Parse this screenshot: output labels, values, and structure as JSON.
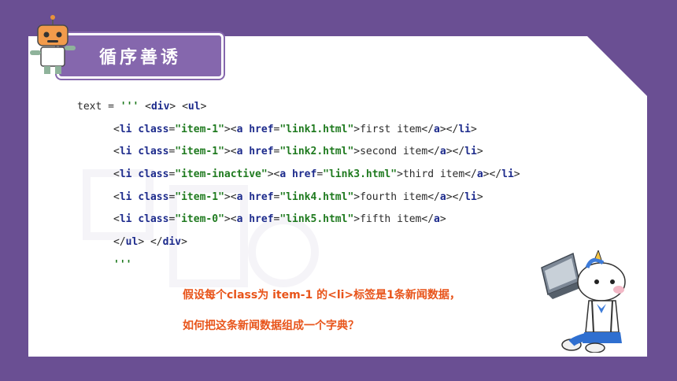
{
  "title": "循序善诱",
  "code_lines": [
    {
      "parts": [
        [
          "pl",
          "text = "
        ],
        [
          "st",
          "'''"
        ],
        [
          "pl",
          " <"
        ],
        [
          "kw",
          "div"
        ],
        [
          "pl",
          "> <"
        ],
        [
          "kw",
          "ul"
        ],
        [
          "pl",
          ">"
        ]
      ],
      "indent": false
    },
    {
      "parts": [
        [
          "pl",
          "<"
        ],
        [
          "kw",
          "li"
        ],
        [
          "pl",
          " "
        ],
        [
          "at",
          "class"
        ],
        [
          "pl",
          "="
        ],
        [
          "st",
          "\"item-1\""
        ],
        [
          "pl",
          "><"
        ],
        [
          "kw",
          "a"
        ],
        [
          "pl",
          " "
        ],
        [
          "at",
          "href"
        ],
        [
          "pl",
          "="
        ],
        [
          "st",
          "\"link1.html\""
        ],
        [
          "pl",
          ">first item</"
        ],
        [
          "kw",
          "a"
        ],
        [
          "pl",
          "></"
        ],
        [
          "kw",
          "li"
        ],
        [
          "pl",
          ">"
        ]
      ],
      "indent": true
    },
    {
      "parts": [
        [
          "pl",
          "<"
        ],
        [
          "kw",
          "li"
        ],
        [
          "pl",
          " "
        ],
        [
          "at",
          "class"
        ],
        [
          "pl",
          "="
        ],
        [
          "st",
          "\"item-1\""
        ],
        [
          "pl",
          "><"
        ],
        [
          "kw",
          "a"
        ],
        [
          "pl",
          " "
        ],
        [
          "at",
          "href"
        ],
        [
          "pl",
          "="
        ],
        [
          "st",
          "\"link2.html\""
        ],
        [
          "pl",
          ">second item</"
        ],
        [
          "kw",
          "a"
        ],
        [
          "pl",
          "></"
        ],
        [
          "kw",
          "li"
        ],
        [
          "pl",
          ">"
        ]
      ],
      "indent": true
    },
    {
      "parts": [
        [
          "pl",
          "<"
        ],
        [
          "kw",
          "li"
        ],
        [
          "pl",
          " "
        ],
        [
          "at",
          "class"
        ],
        [
          "pl",
          "="
        ],
        [
          "st",
          "\"item-inactive\""
        ],
        [
          "pl",
          "><"
        ],
        [
          "kw",
          "a"
        ],
        [
          "pl",
          " "
        ],
        [
          "at",
          "href"
        ],
        [
          "pl",
          "="
        ],
        [
          "st",
          "\"link3.html\""
        ],
        [
          "pl",
          ">third item</"
        ],
        [
          "kw",
          "a"
        ],
        [
          "pl",
          "></"
        ],
        [
          "kw",
          "li"
        ],
        [
          "pl",
          ">"
        ]
      ],
      "indent": true
    },
    {
      "parts": [
        [
          "pl",
          "<"
        ],
        [
          "kw",
          "li"
        ],
        [
          "pl",
          " "
        ],
        [
          "at",
          "class"
        ],
        [
          "pl",
          "="
        ],
        [
          "st",
          "\"item-1\""
        ],
        [
          "pl",
          "><"
        ],
        [
          "kw",
          "a"
        ],
        [
          "pl",
          " "
        ],
        [
          "at",
          "href"
        ],
        [
          "pl",
          "="
        ],
        [
          "st",
          "\"link4.html\""
        ],
        [
          "pl",
          ">fourth item</"
        ],
        [
          "kw",
          "a"
        ],
        [
          "pl",
          "></"
        ],
        [
          "kw",
          "li"
        ],
        [
          "pl",
          ">"
        ]
      ],
      "indent": true
    },
    {
      "parts": [
        [
          "pl",
          "<"
        ],
        [
          "kw",
          "li"
        ],
        [
          "pl",
          " "
        ],
        [
          "at",
          "class"
        ],
        [
          "pl",
          "="
        ],
        [
          "st",
          "\"item-0\""
        ],
        [
          "pl",
          "><"
        ],
        [
          "kw",
          "a"
        ],
        [
          "pl",
          " "
        ],
        [
          "at",
          "href"
        ],
        [
          "pl",
          "="
        ],
        [
          "st",
          "\"link5.html\""
        ],
        [
          "pl",
          ">fifth item</"
        ],
        [
          "kw",
          "a"
        ],
        [
          "pl",
          ">"
        ]
      ],
      "indent": true
    },
    {
      "parts": [
        [
          "pl",
          "</"
        ],
        [
          "kw",
          "ul"
        ],
        [
          "pl",
          "> </"
        ],
        [
          "kw",
          "div"
        ],
        [
          "pl",
          ">"
        ]
      ],
      "indent": true
    },
    {
      "parts": [
        [
          "st",
          "'''"
        ]
      ],
      "indent": true
    }
  ],
  "question_line1": "假设每个class为 item-1 的<li>标签是1条新闻数据，",
  "question_line2": "如何把这条新闻数据组成一个字典？",
  "colors": {
    "background": "#6a4f93",
    "tab": "#8567ad",
    "question": "#e8541a",
    "keyword": "#1d2b8c",
    "string": "#1f7a1f"
  },
  "icons": {
    "robot": "robot-icon",
    "mascot": "unicorn-laptop-mascot-icon"
  }
}
